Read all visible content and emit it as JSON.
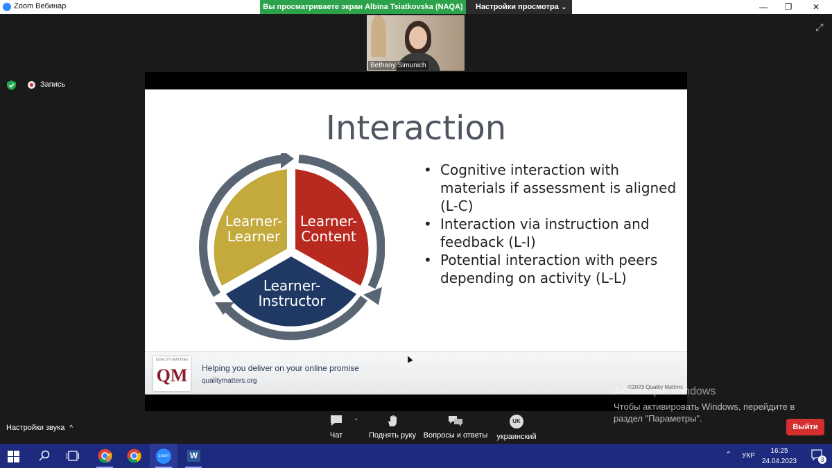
{
  "window": {
    "app_title": "Zoom Вебинар",
    "share_banner": "Вы просматриваете экран Albina Tsiatkovska (NAQA)",
    "view_options": "Настройки просмотра",
    "controls": {
      "minimize": "—",
      "restore": "❐",
      "close": "✕"
    }
  },
  "video": {
    "participant_name": "Bethany Simunich"
  },
  "recording": {
    "label": "Запись"
  },
  "slide": {
    "title": "Interaction",
    "segments": {
      "left": [
        "Learner-",
        "Learner"
      ],
      "right": [
        "Learner-",
        "Content"
      ],
      "bottom": [
        "Learner-",
        "Instructor"
      ]
    },
    "bullets": [
      "Cognitive interaction with materials if assessment is aligned (L-C)",
      "Interaction via instruction and feedback (L-I)",
      "Potential interaction with peers depending on activity (L-L)"
    ],
    "footer": {
      "logo_small": "QUALITY MATTERS",
      "logo_big": "QM",
      "tagline": "Helping you deliver on your online promise",
      "site": "qualitymatters.org",
      "copyright": "©2023 Quality Matters"
    },
    "colors": {
      "gold": "#c4a93c",
      "red": "#b8291f",
      "navy": "#1f3864",
      "ring": "#5a6573"
    }
  },
  "watermark": {
    "title": "Активация Windows",
    "text": "Чтобы активировать Windows, перейдите в раздел \"Параметры\"."
  },
  "toolbar": {
    "audio_settings": "Настройки звука",
    "audio_caret": "^",
    "chat": "Чат",
    "raise_hand": "Поднять руку",
    "qa": "Вопросы и ответы",
    "interpretation": "украинский",
    "interpretation_badge": "UK",
    "exit": "Выйти"
  },
  "taskbar": {
    "language": "УКР",
    "time": "16:25",
    "date": "24.04.2023",
    "notifications": "3",
    "zoom_label": "zoom",
    "word_label": "W"
  }
}
